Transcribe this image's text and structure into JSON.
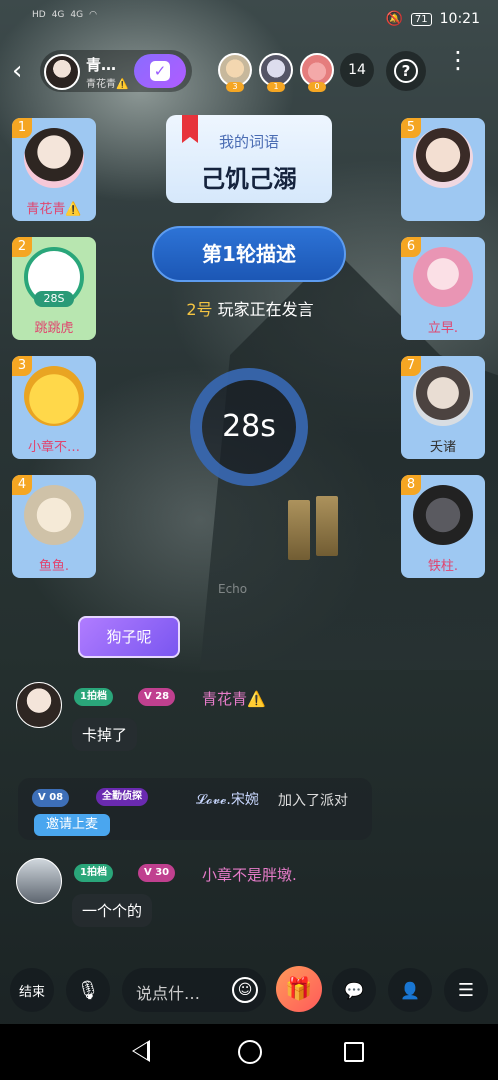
{
  "status_bar": {
    "sig1": "HD",
    "sig2": "HD",
    "net1": "4G",
    "net2": "4G",
    "battery": "71",
    "time": "10:21"
  },
  "header": {
    "host_name": "青…",
    "host_sub": "青花青⚠️",
    "viewers": [
      {
        "count": "3"
      },
      {
        "count": "1"
      },
      {
        "count": "0"
      }
    ],
    "viewer_total": "14"
  },
  "seats": [
    {
      "num": "1",
      "name": "青花青⚠️"
    },
    {
      "num": "2",
      "name": "跳跳虎",
      "timer": "28S"
    },
    {
      "num": "3",
      "name": "小章不…"
    },
    {
      "num": "4",
      "name": "鱼鱼."
    },
    {
      "num": "5",
      "name": ""
    },
    {
      "num": "6",
      "name": "立早."
    },
    {
      "num": "7",
      "name": "夭诸"
    },
    {
      "num": "8",
      "name": "铁柱."
    }
  ],
  "game": {
    "word_label": "我的词语",
    "word": "己饥己溺",
    "round": "第1轮描述",
    "speaker_num": "2号",
    "speaker_text": " 玩家正在发言",
    "timer": "28s"
  },
  "chat": {
    "faded_text": "Echo",
    "gift_text": "狗子呢",
    "msg1": {
      "tag1": "1拍档",
      "tag2": "V 28",
      "name": "青花青⚠️",
      "text": "卡掉了"
    },
    "system": {
      "tag1": "V 08",
      "tag2": "全勤侦探",
      "name": "𝓛𝓸𝓿𝓮.宋婉",
      "text": "加入了派对",
      "invite": "邀请上麦"
    },
    "msg2": {
      "tag1": "1拍档",
      "tag2": "V 30",
      "name": "小章不是胖墩.",
      "text": "一个个的"
    }
  },
  "bottom": {
    "end_label": "结束",
    "input_placeholder": "说点什…"
  }
}
